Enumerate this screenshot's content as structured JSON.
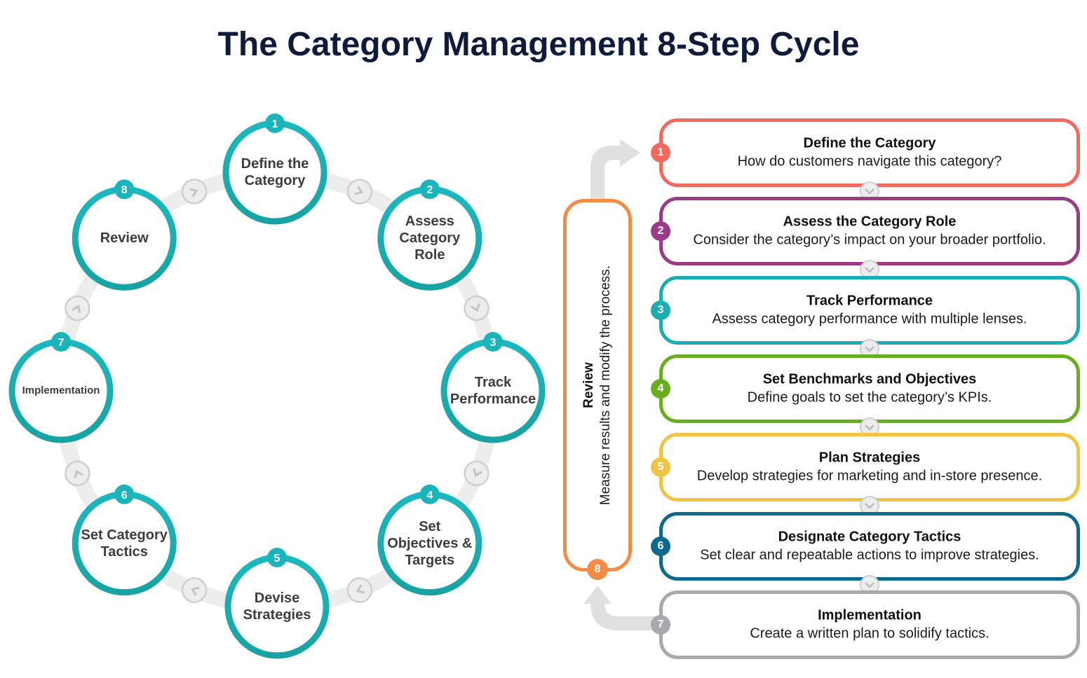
{
  "title": "The Category Management 8-Step Cycle",
  "colors": {
    "cycle_teal": "#1ab0b5",
    "track_gray": "#ededed",
    "review_orange": "#f58c45",
    "arrow_gray": "#e0e0e0"
  },
  "cycle": {
    "steps": [
      {
        "number": "1",
        "label": "Define the Category"
      },
      {
        "number": "2",
        "label": "Assess Category Role"
      },
      {
        "number": "3",
        "label": "Track Performance"
      },
      {
        "number": "4",
        "label": "Set Objectives & Targets"
      },
      {
        "number": "5",
        "label": "Devise Strategies"
      },
      {
        "number": "6",
        "label": "Set Category Tactics"
      },
      {
        "number": "7",
        "label": "Implementation"
      },
      {
        "number": "8",
        "label": "Review"
      }
    ],
    "connector_icon": "chevron-icon"
  },
  "steps": [
    {
      "number": "1",
      "title": "Define the Category",
      "description": "How do customers navigate this category?",
      "color": "#f06b5e"
    },
    {
      "number": "2",
      "title": "Assess the Category Role",
      "description": "Consider the category’s impact on your broader portfolio.",
      "color": "#9a3b88"
    },
    {
      "number": "3",
      "title": "Track Performance",
      "description": "Assess category performance with multiple lenses.",
      "color": "#1aaeb3"
    },
    {
      "number": "4",
      "title": "Set Benchmarks and Objectives",
      "description": "Define goals to set the category’s KPIs.",
      "color": "#6aad1e"
    },
    {
      "number": "5",
      "title": "Plan Strategies",
      "description": "Develop strategies for marketing and in-store presence.",
      "color": "#f2c444"
    },
    {
      "number": "6",
      "title": "Designate Category Tactics",
      "description": "Set clear and repeatable actions to improve strategies.",
      "color": "#0d6a8e"
    },
    {
      "number": "7",
      "title": "Implementation",
      "description": "Create a written plan to solidify tactics.",
      "color": "#a7a9ac"
    }
  ],
  "review": {
    "number": "8",
    "title": "Review",
    "description": "Measure results and modify the process."
  },
  "chevron_icon": "chevron-down-icon"
}
